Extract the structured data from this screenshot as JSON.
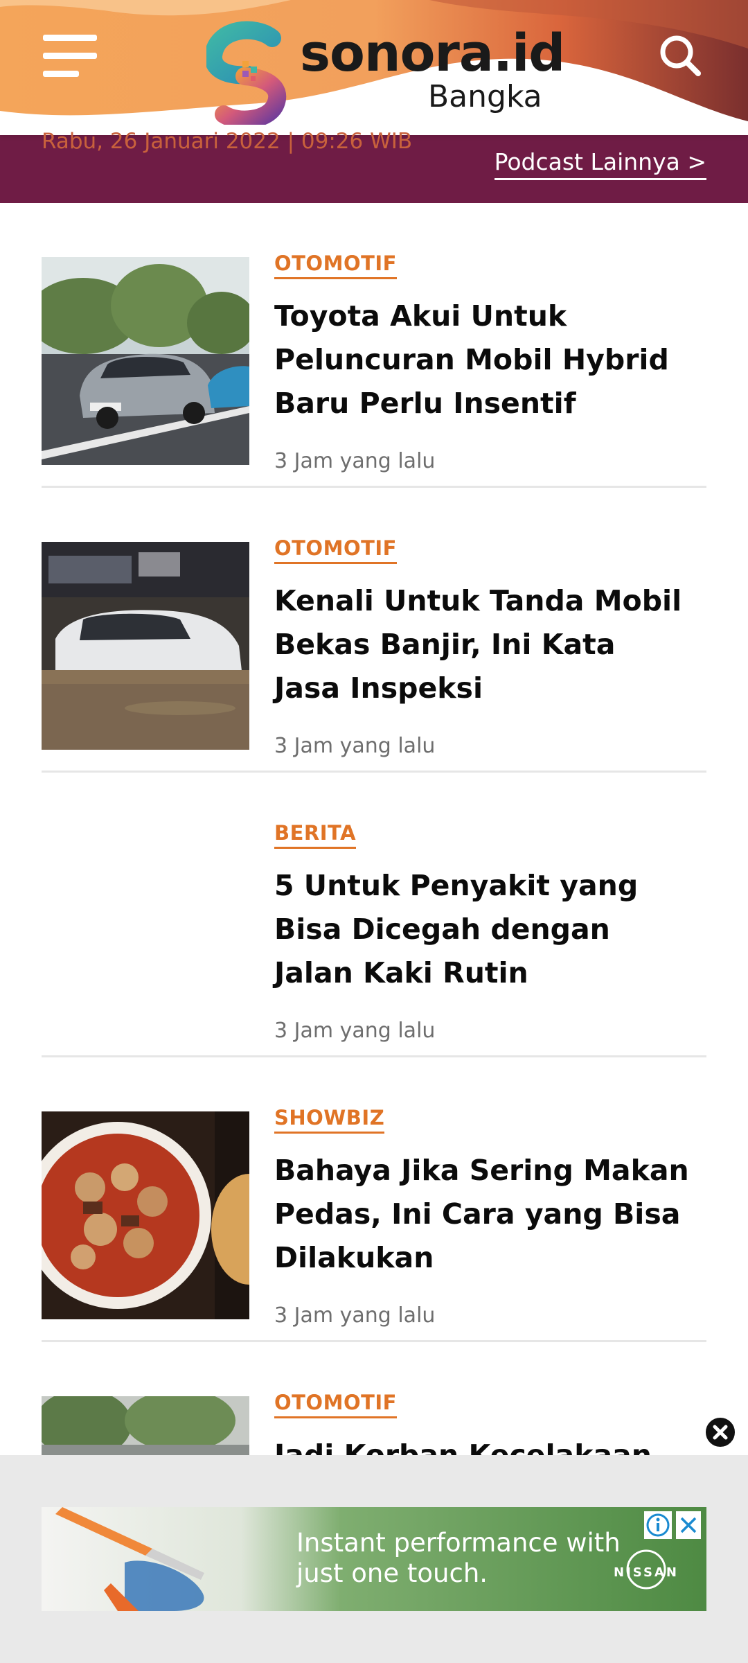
{
  "header": {
    "logo_text": "sonora.id",
    "logo_sub": "Bangka",
    "menu_icon": "hamburger-menu-icon",
    "search_icon": "search-icon"
  },
  "topbar": {
    "date": "Rabu, 26 Januari 2022 | 09:26 WIB",
    "podcast_link": "Podcast Lainnya >"
  },
  "articles": [
    {
      "category": "OTOMOTIF",
      "title": "Toyota Akui Untuk Peluncuran Mobil Hybrid Baru Perlu Insentif",
      "time": "3 Jam yang lalu"
    },
    {
      "category": "OTOMOTIF",
      "title": "Kenali Untuk Tanda Mobil Bekas Banjir, Ini Kata Jasa Inspeksi",
      "time": "3 Jam yang lalu"
    },
    {
      "category": "BERITA",
      "title": "5 Untuk Penyakit yang Bisa Dicegah dengan Jalan Kaki Rutin",
      "time": "3 Jam yang lalu"
    },
    {
      "category": "SHOWBIZ",
      "title": "Bahaya Jika Sering Makan Pedas, Ini Cara yang Bisa Dilakukan",
      "time": "3 Jam yang lalu"
    },
    {
      "category": "OTOMOTIF",
      "title": "Jadi Korban Kecelakaan",
      "time": ""
    }
  ],
  "ad": {
    "text": "Instant performance with just one touch.",
    "brand": "NISSAN",
    "info_icon": "ad-info-icon",
    "close_icon": "ad-close-icon"
  },
  "colors": {
    "accent": "#e07426",
    "podcast_bar": "#6f1c45",
    "ad_green": "#5d9a4f"
  }
}
